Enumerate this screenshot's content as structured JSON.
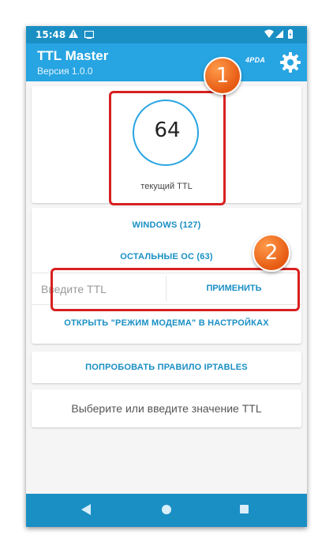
{
  "status_bar": {
    "time": "15:48"
  },
  "app_bar": {
    "title": "TTL Master",
    "subtitle": "Версия 1.0.0",
    "forum_logo": "4PDA"
  },
  "ttl_card": {
    "value": "64",
    "label": "текущий TTL"
  },
  "os_card": {
    "windows_button": "WINDOWS (127)",
    "other_os_button": "ОСТАЛЬНЫЕ ОС (63)",
    "ttl_input_placeholder": "Введите TTL",
    "apply_button": "ПРИМЕНИТЬ",
    "modem_settings_button": "ОТКРЫТЬ \"РЕЖИМ МОДЕМА\" В НАСТРОЙКАХ"
  },
  "iptables_button": "ПОПРОБОВАТЬ ПРАВИЛО IPTABLES",
  "hint": "Выберите или введите значение TTL",
  "callouts": [
    {
      "number": "1"
    },
    {
      "number": "2"
    }
  ],
  "colors": {
    "accent": "#27a4e2",
    "status_bar": "#1a8fc4",
    "callout_red": "#d82020",
    "badge_orange": "#f07a28"
  }
}
